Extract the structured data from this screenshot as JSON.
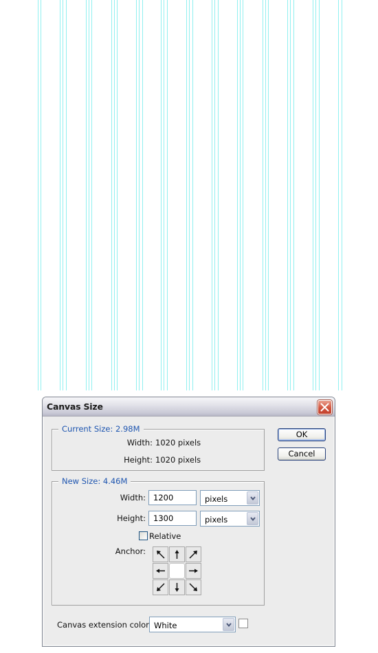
{
  "canvas": {
    "guide_color": "#8ff0f0",
    "background": "#ffffff"
  },
  "dialog": {
    "title": "Canvas Size",
    "close_icon": "close-icon",
    "current_size": {
      "legend": "Current Size: 2.98M",
      "width_label": "Width:",
      "width_value": "1020 pixels",
      "height_label": "Height:",
      "height_value": "1020 pixels"
    },
    "new_size": {
      "legend": "New Size: 4.46M",
      "width_label": "Width:",
      "width_value": "1200",
      "width_unit": "pixels",
      "height_label": "Height:",
      "height_value": "1300",
      "height_unit": "pixels",
      "relative_label": "Relative",
      "relative_checked": false,
      "anchor_label": "Anchor:",
      "anchor_selected": "center"
    },
    "extension": {
      "label": "Canvas extension color:",
      "value": "White",
      "swatch_color": "#ffffff"
    },
    "buttons": {
      "ok": "OK",
      "cancel": "Cancel"
    }
  }
}
